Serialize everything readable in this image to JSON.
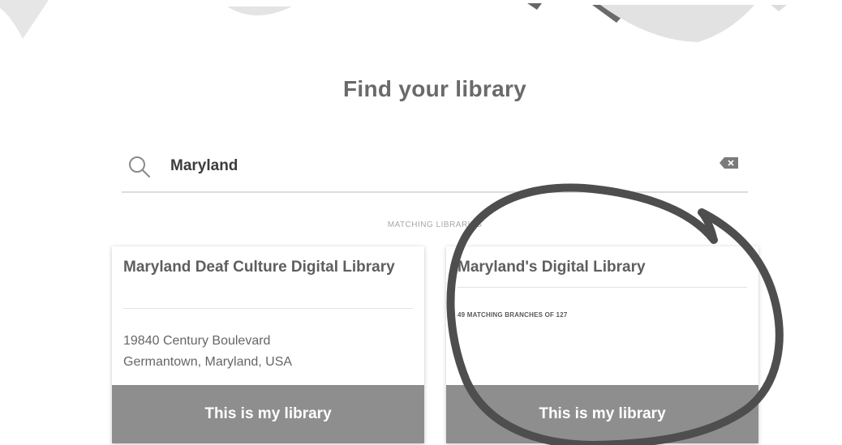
{
  "page": {
    "title": "Find your library"
  },
  "search": {
    "value": "Maryland",
    "placeholder": ""
  },
  "results": {
    "label": "MATCHING LIBRARIES",
    "cards": [
      {
        "title": "Maryland Deaf Culture Digital Library",
        "address_line1": "19840 Century Boulevard",
        "address_line2": "Germantown, Maryland, USA",
        "button_label": "This is my library"
      },
      {
        "title": "Maryland's Digital Library",
        "branches": "49 MATCHING BRANCHES OF 127",
        "button_label": "This is my library"
      }
    ]
  },
  "icons": {
    "search": "search-icon",
    "clear": "clear-icon"
  },
  "colors": {
    "button": "#8e8e8e",
    "title": "#6a6a6a",
    "annotation": "#555555"
  }
}
